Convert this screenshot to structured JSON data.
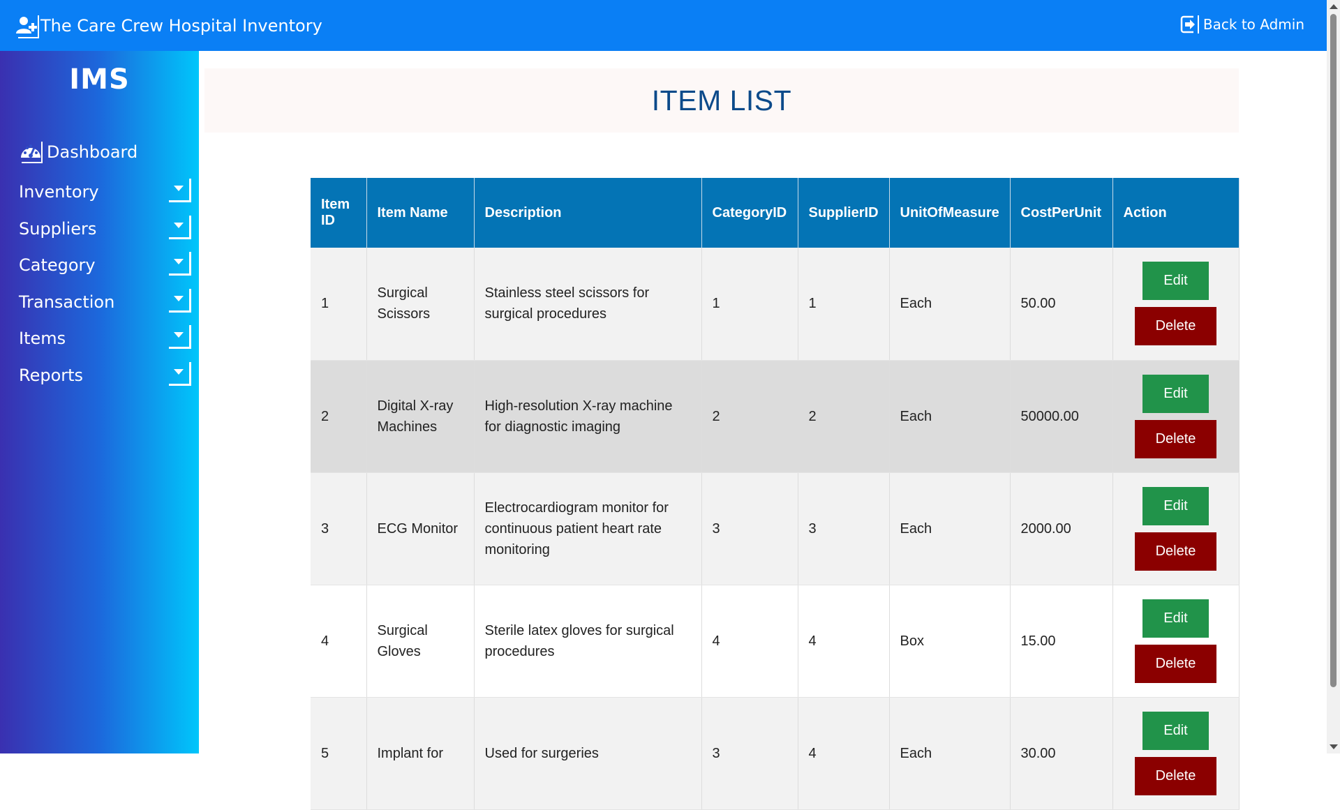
{
  "header": {
    "title": "The Care Crew Hospital Inventory",
    "back_label": "Back to Admin",
    "brand_icon": "user-plus-icon",
    "back_icon": "sign-out-icon",
    "bg_color": "#0a7ff5"
  },
  "sidebar": {
    "logo": "IMS",
    "dashboard_label": "Dashboard",
    "dashboard_icon": "tachometer-icon",
    "items": [
      {
        "label": "Inventory"
      },
      {
        "label": "Suppliers"
      },
      {
        "label": "Category"
      },
      {
        "label": "Transaction"
      },
      {
        "label": "Items"
      },
      {
        "label": "Reports"
      }
    ]
  },
  "main": {
    "title": "ITEM LIST",
    "columns": [
      "Item ID",
      "Item Name",
      "Description",
      "CategoryID",
      "SupplierID",
      "UnitOfMeasure",
      "CostPerUnit",
      "Action"
    ],
    "edit_label": "Edit",
    "delete_label": "Delete",
    "rows": [
      {
        "id": "1",
        "name": "Surgical Scissors",
        "description": "Stainless steel scissors for surgical procedures",
        "category_id": "1",
        "supplier_id": "1",
        "unit": "Each",
        "cost": "50.00"
      },
      {
        "id": "2",
        "name": "Digital X-ray Machines",
        "description": "High-resolution X-ray machine for diagnostic imaging",
        "category_id": "2",
        "supplier_id": "2",
        "unit": "Each",
        "cost": "50000.00"
      },
      {
        "id": "3",
        "name": "ECG Monitor",
        "description": "Electrocardiogram monitor for continuous patient heart rate monitoring",
        "category_id": "3",
        "supplier_id": "3",
        "unit": "Each",
        "cost": "2000.00"
      },
      {
        "id": "4",
        "name": "Surgical Gloves",
        "description": "Sterile latex gloves for surgical procedures",
        "category_id": "4",
        "supplier_id": "4",
        "unit": "Box",
        "cost": "15.00"
      },
      {
        "id": "5",
        "name": "Implant for",
        "description": "Used for surgeries",
        "category_id": "3",
        "supplier_id": "4",
        "unit": "Each",
        "cost": "30.00"
      }
    ]
  }
}
